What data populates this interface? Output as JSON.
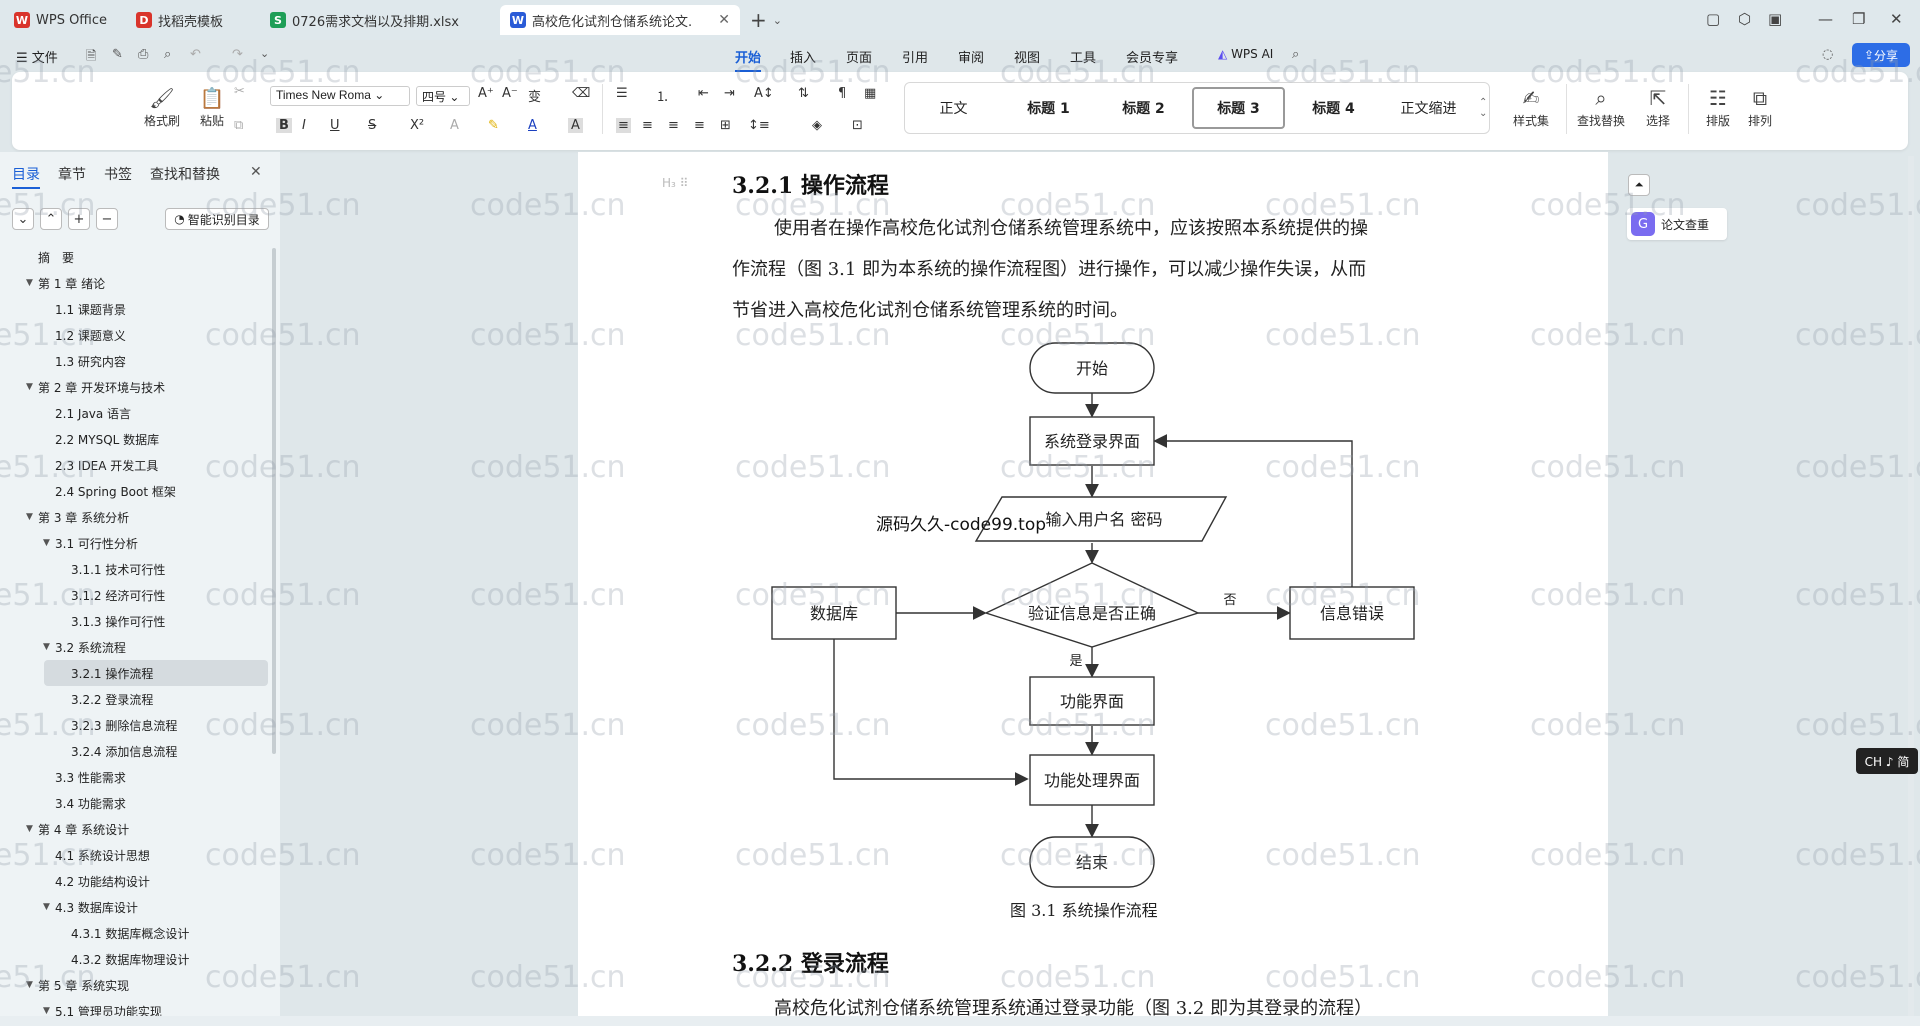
{
  "tabs": [
    {
      "label": "WPS Office",
      "logo": "W",
      "color": "#d9342b"
    },
    {
      "label": "找稻壳模板",
      "logo": "D",
      "color": "#d9342b"
    },
    {
      "label": "0726需求文档以及排期.xlsx",
      "logo": "S",
      "color": "#1e9e57"
    },
    {
      "label": "高校危化试剂仓储系统论文.do",
      "logo": "W",
      "color": "#2a5bd7"
    }
  ],
  "menu": {
    "file": "文件",
    "items": [
      "开始",
      "插入",
      "页面",
      "引用",
      "审阅",
      "视图",
      "工具",
      "会员专享"
    ],
    "wps_ai": "WPS AI",
    "share": "分享"
  },
  "ribbon": {
    "format_painter": "格式刷",
    "paste": "粘贴",
    "font_name": "Times New Roma",
    "font_size": "四号",
    "styles": [
      "正文",
      "标题 1",
      "标题 2",
      "标题 3",
      "标题 4",
      "正文缩进"
    ],
    "style_set": "样式集",
    "find_replace": "查找替换",
    "select": "选择",
    "layout": "排版",
    "arrange": "排列"
  },
  "sidebar": {
    "tabs": [
      "目录",
      "章节",
      "书签",
      "查找和替换"
    ],
    "smart_toc": "智能识别目录",
    "toc": [
      {
        "label": "摘　要",
        "level": 0,
        "arrow": false
      },
      {
        "label": "第 1 章  绪论",
        "level": 0,
        "arrow": true
      },
      {
        "label": "1.1  课题背景",
        "level": 1,
        "arrow": false
      },
      {
        "label": "1.2  课题意义",
        "level": 1,
        "arrow": false
      },
      {
        "label": "1.3  研究内容",
        "level": 1,
        "arrow": false
      },
      {
        "label": "第 2 章  开发环境与技术",
        "level": 0,
        "arrow": true
      },
      {
        "label": "2.1 Java 语言",
        "level": 1,
        "arrow": false
      },
      {
        "label": "2.2 MYSQL 数据库",
        "level": 1,
        "arrow": false
      },
      {
        "label": "2.3 IDEA 开发工具",
        "level": 1,
        "arrow": false
      },
      {
        "label": "2.4 Spring Boot 框架",
        "level": 1,
        "arrow": false
      },
      {
        "label": "第 3 章  系统分析",
        "level": 0,
        "arrow": true
      },
      {
        "label": "3.1  可行性分析",
        "level": 1,
        "arrow": true
      },
      {
        "label": "3.1.1  技术可行性",
        "level": 2,
        "arrow": false
      },
      {
        "label": "3.1.2  经济可行性",
        "level": 2,
        "arrow": false
      },
      {
        "label": "3.1.3  操作可行性",
        "level": 2,
        "arrow": false
      },
      {
        "label": "3.2  系统流程",
        "level": 1,
        "arrow": true
      },
      {
        "label": "3.2.1  操作流程",
        "level": 2,
        "arrow": false,
        "active": true
      },
      {
        "label": "3.2.2  登录流程",
        "level": 2,
        "arrow": false
      },
      {
        "label": "3.2.3  删除信息流程",
        "level": 2,
        "arrow": false
      },
      {
        "label": "3.2.4  添加信息流程",
        "level": 2,
        "arrow": false
      },
      {
        "label": "3.3  性能需求",
        "level": 1,
        "arrow": false
      },
      {
        "label": "3.4  功能需求",
        "level": 1,
        "arrow": false
      },
      {
        "label": "第 4 章  系统设计",
        "level": 0,
        "arrow": true
      },
      {
        "label": "4.1  系统设计思想",
        "level": 1,
        "arrow": false
      },
      {
        "label": "4.2  功能结构设计",
        "level": 1,
        "arrow": false
      },
      {
        "label": "4.3  数据库设计",
        "level": 1,
        "arrow": true
      },
      {
        "label": "4.3.1  数据库概念设计",
        "level": 2,
        "arrow": false
      },
      {
        "label": "4.3.2  数据库物理设计",
        "level": 2,
        "arrow": false
      },
      {
        "label": "第 5 章  系统实现",
        "level": 0,
        "arrow": true
      },
      {
        "label": "5.1  管理员功能实现",
        "level": 1,
        "arrow": true
      }
    ]
  },
  "document": {
    "heading1": "3.2.1  操作流程",
    "para1_lines": [
      "使用者在操作高校危化试剂仓储系统管理系统中，应该按照本系统提供的操",
      "作流程（图 3.1 即为本系统的操作流程图）进行操作，可以减少操作失误，从而",
      "节省进入高校危化试剂仓储系统管理系统的时间。"
    ],
    "flowchart": {
      "start": "开始",
      "login": "系统登录界面",
      "input": "输入用户名 密码",
      "verify": "验证信息是否正确",
      "database": "数据库",
      "error": "信息错误",
      "no": "否",
      "yes": "是",
      "function": "功能界面",
      "processing": "功能处理界面",
      "end": "结束"
    },
    "overlay_text": "源码久久-code99.top",
    "caption": "图 3.1  系统操作流程",
    "heading2": "3.2.2  登录流程",
    "para2": "高校危化试剂仓储系统管理系统通过登录功能（图 3.2 即为其登录的流程）"
  },
  "right_panel": {
    "thesis_check": "论文查重",
    "ime": "CH ♪ 简"
  },
  "watermark": "code51.cn"
}
